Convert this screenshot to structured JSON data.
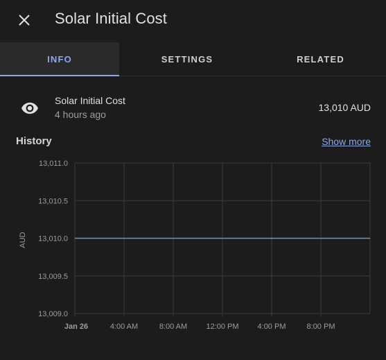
{
  "dialog": {
    "title": "Solar Initial Cost"
  },
  "tabs": [
    {
      "label": "INFO",
      "active": true
    },
    {
      "label": "SETTINGS",
      "active": false
    },
    {
      "label": "RELATED",
      "active": false
    }
  ],
  "entity": {
    "name": "Solar Initial Cost",
    "last_changed": "4 hours ago",
    "state": "13,010 AUD",
    "icon": "eye-icon"
  },
  "history": {
    "title": "History",
    "show_more": "Show more"
  },
  "colors": {
    "background": "#1c1c1c",
    "accent": "#8fa8e6",
    "line": "#6f8fd6",
    "grid": "#3a3a3a"
  },
  "chart_data": {
    "type": "line",
    "ylabel": "AUD",
    "ylim": [
      13009.0,
      13011.0
    ],
    "yticks": [
      "13,011.0",
      "13,010.5",
      "13,010.0",
      "13,009.5",
      "13,009.0"
    ],
    "xticks": [
      "Jan 26",
      "4:00 AM",
      "8:00 AM",
      "12:00 PM",
      "4:00 PM",
      "8:00 PM"
    ],
    "xrange_hours": [
      0,
      24
    ],
    "grid": true,
    "series": [
      {
        "x": [
          0,
          24
        ],
        "y": [
          13010.0,
          13010.0
        ]
      }
    ]
  }
}
